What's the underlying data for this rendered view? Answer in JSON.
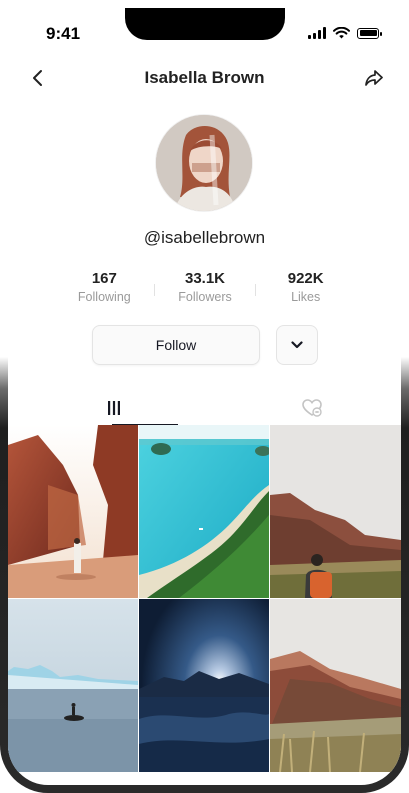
{
  "status_bar": {
    "time": "9:41"
  },
  "header": {
    "title": "Isabella Brown"
  },
  "profile": {
    "handle": "@isabellebrown"
  },
  "stats": [
    {
      "value": "167",
      "label": "Following"
    },
    {
      "value": "33.1K",
      "label": "Followers"
    },
    {
      "value": "922K",
      "label": "Likes"
    }
  ],
  "actions": {
    "follow_label": "Follow"
  },
  "icons": {
    "back": "chevron-left-icon",
    "share": "share-arrow-icon",
    "more": "chevron-down-icon",
    "videos_tab": "grid-bars-icon",
    "liked_tab": "heart-hidden-icon"
  },
  "grid": {
    "thumbnails": [
      {
        "subject": "red canyon with hiker in white"
      },
      {
        "subject": "turquoise sea and forested coast aerial"
      },
      {
        "subject": "hiker with orange backpack and red cliffs"
      },
      {
        "subject": "icebergs and kayaker on grey water"
      },
      {
        "subject": "night sky over mountains and snowy shore"
      },
      {
        "subject": "red rock mountain with dry grass"
      }
    ]
  }
}
